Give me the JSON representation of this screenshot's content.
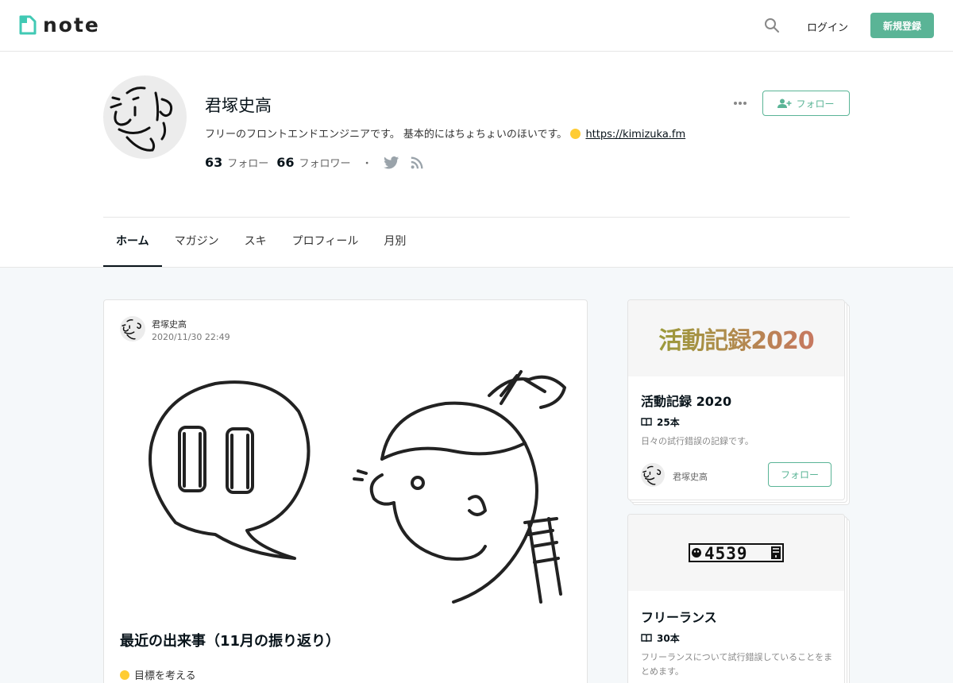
{
  "header": {
    "logo_text": "note",
    "login_label": "ログイン",
    "signup_label": "新規登録"
  },
  "profile": {
    "name": "君塚史高",
    "bio_text": "フリーのフロントエンドエンジニアです。 基本的にはちょちょいのほいです。",
    "bio_link": "https://kimizuka.fm",
    "following_count": "63",
    "following_label": "フォロー",
    "followers_count": "66",
    "followers_label": "フォロワー",
    "separator": "・",
    "follow_label": "フォロー"
  },
  "tabs": [
    {
      "label": "ホーム",
      "active": true
    },
    {
      "label": "マガジン",
      "active": false
    },
    {
      "label": "スキ",
      "active": false
    },
    {
      "label": "プロフィール",
      "active": false
    },
    {
      "label": "月別",
      "active": false
    }
  ],
  "post": {
    "author": "君塚史高",
    "date": "2020/11/30 22:49",
    "title": "最近の出来事（11月の振り返り）",
    "excerpt": "目標を考える",
    "bubble_text": "11"
  },
  "magazines": [
    {
      "cover_text": "活動記録2020",
      "title": "活動記録 2020",
      "count": "25本",
      "description": "日々の試行錯誤の記録です。",
      "owner": "君塚史高",
      "follow_label": "フォロー"
    },
    {
      "cover_text": "4539",
      "title": "フリーランス",
      "count": "30本",
      "description": "フリーランスについて試行錯誤していることをまとめます。"
    }
  ],
  "colors": {
    "accent": "#5ab496",
    "text": "#08131a",
    "page_bg": "#f5f8fa"
  }
}
